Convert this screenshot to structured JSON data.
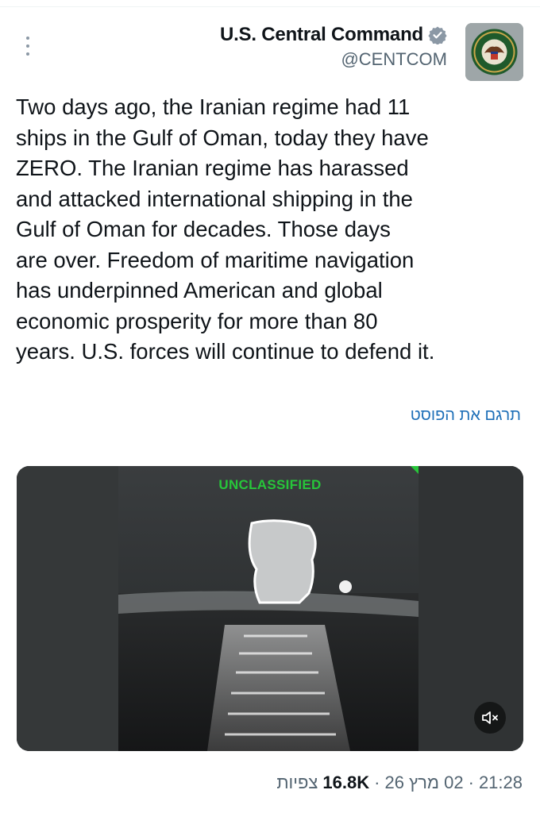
{
  "tweet": {
    "author_name": "U.S. Central Command",
    "author_handle": "@CENTCOM",
    "verified_icon": "verified-badge-icon",
    "avatar_icon": "centcom-seal",
    "text": "Two days ago, the Iranian regime had 11\nships in the Gulf of Oman, today they have\nZERO. The Iranian regime has harassed\nand attacked international shipping in the\nGulf of Oman for decades. Those days\nare over. Freedom of maritime navigation\nhas underpinned American and global\neconomic prosperity for more than 80\nyears. U.S. forces will continue to defend it.",
    "translate_label": "תרגם את הפוסט",
    "media": {
      "overlay_label": "UNCLASSIFIED",
      "mute_icon": "speaker-muted-icon"
    },
    "meta": {
      "time": "21:28",
      "sep1": "·",
      "date": "02 מרץ 26",
      "sep2": "·",
      "views_count": "16.8K",
      "views_label": "צפיות"
    }
  },
  "colors": {
    "secondary_text": "#536471",
    "link": "#1d6fb8",
    "classified_green": "#27c63a",
    "verified_gray": "#8b98a5"
  }
}
